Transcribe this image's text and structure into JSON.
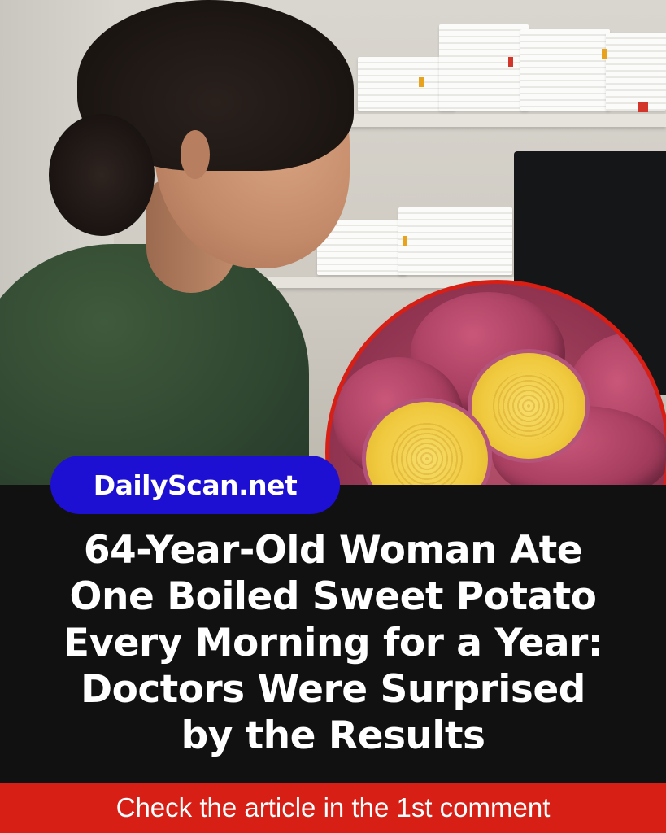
{
  "badge": {
    "label": "DailyScan.net"
  },
  "headline": {
    "lines": [
      "64-Year-Old Woman Ate",
      "One Boiled Sweet Potato",
      "Every Morning for a Year:",
      "Doctors Were Surprised",
      "by the Results"
    ]
  },
  "footer": {
    "cta": "Check the article in the 1st comment"
  },
  "colors": {
    "accent_red": "#d71f16",
    "badge_blue": "#1e10d3",
    "band_black": "#111111"
  },
  "images": {
    "main_photo": "woman-in-green-shirt-photo",
    "inset_photo": "sweet-potatoes-photo"
  }
}
